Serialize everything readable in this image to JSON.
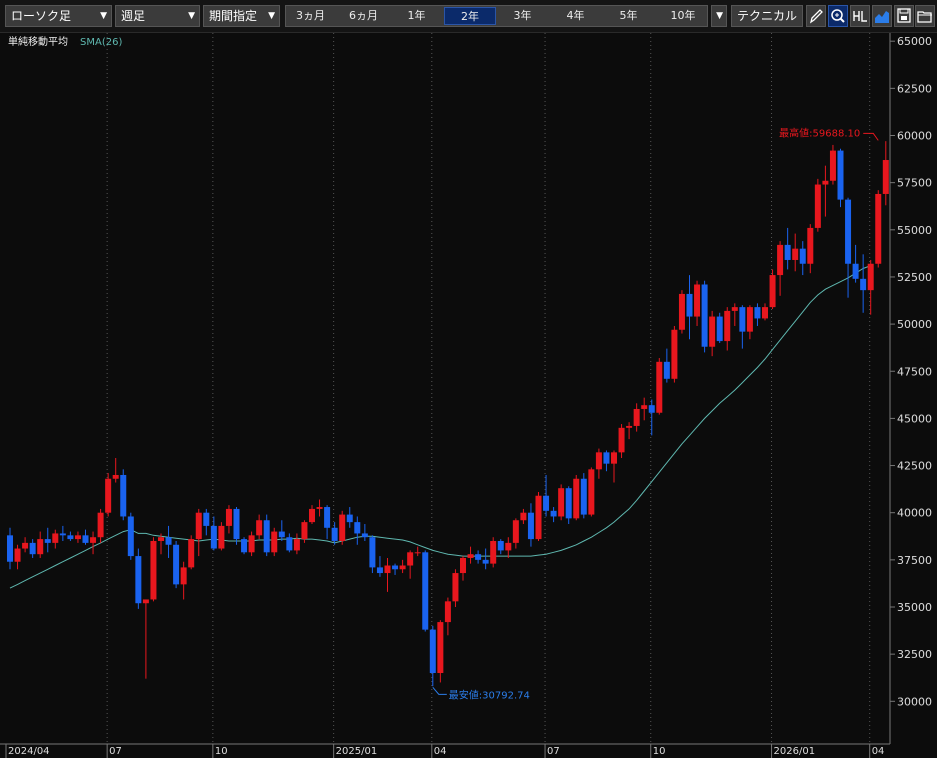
{
  "toolbar": {
    "chart_type": "ローソク足",
    "interval": "週足",
    "period_mode": "期間指定",
    "periods": [
      "3ヵ月",
      "6ヵ月",
      "1年",
      "2年",
      "3年",
      "4年",
      "5年",
      "10年"
    ],
    "selected_period": "2年",
    "technical": "テクニカル",
    "icons": [
      "pencil-icon",
      "zoom-icon",
      "output-icon",
      "chart-style-icon",
      "save-icon",
      "folder-icon"
    ]
  },
  "legend": {
    "indicator": "単純移動平均",
    "sma": "SMA(26)"
  },
  "annotations": {
    "high": "最高値:59688.10",
    "low": "最安値:30792.74"
  },
  "colors": {
    "up": "#e8171e",
    "down": "#1a63f0",
    "sma": "#5fb8b0",
    "background": "#0c0c0c",
    "grid": "#555555"
  },
  "chart_data": {
    "type": "candlestick",
    "interval": "weekly",
    "y_ticks": [
      "65000",
      "62500",
      "60000",
      "57500",
      "55000",
      "52500",
      "50000",
      "47500",
      "45000",
      "42500",
      "40000",
      "37500",
      "35000",
      "32500",
      "30000"
    ],
    "ylim": [
      28500,
      65500
    ],
    "x_tick_labels": [
      {
        "label": "2024/04",
        "index": 0
      },
      {
        "label": "07",
        "index": 13
      },
      {
        "label": "10",
        "index": 27
      },
      {
        "label": "2025/01",
        "index": 43
      },
      {
        "label": "04",
        "index": 56
      },
      {
        "label": "07",
        "index": 71
      },
      {
        "label": "10",
        "index": 85
      },
      {
        "label": "2026/01",
        "index": 101
      },
      {
        "label": "04",
        "index": 114
      }
    ],
    "grid": true,
    "series": [
      {
        "type": "ohlc",
        "ohlc": [
          [
            38800,
            39200,
            37000,
            37400
          ],
          [
            37400,
            38300,
            37000,
            38100
          ],
          [
            38100,
            38700,
            37900,
            38400
          ],
          [
            38400,
            38600,
            37600,
            37800
          ],
          [
            37800,
            39000,
            37600,
            38600
          ],
          [
            38600,
            39200,
            37900,
            38400
          ],
          [
            38400,
            39100,
            38100,
            38900
          ],
          [
            38900,
            39300,
            38500,
            38800
          ],
          [
            38800,
            39000,
            38500,
            38600
          ],
          [
            38600,
            39000,
            38400,
            38800
          ],
          [
            38800,
            39100,
            38300,
            38400
          ],
          [
            38400,
            39000,
            37800,
            38700
          ],
          [
            38700,
            40200,
            38400,
            40000
          ],
          [
            40000,
            42100,
            39800,
            41800
          ],
          [
            41800,
            42900,
            41600,
            42000
          ],
          [
            42000,
            42300,
            39600,
            39800
          ],
          [
            39800,
            40000,
            37500,
            37700
          ],
          [
            37700,
            38100,
            34900,
            35200
          ],
          [
            35200,
            35400,
            31200,
            35400
          ],
          [
            35400,
            38700,
            35300,
            38500
          ],
          [
            38500,
            38900,
            37800,
            38700
          ],
          [
            38700,
            39300,
            37600,
            38300
          ],
          [
            38300,
            38500,
            36000,
            36200
          ],
          [
            36200,
            37400,
            35400,
            37100
          ],
          [
            37100,
            38800,
            37000,
            38600
          ],
          [
            38600,
            40200,
            37700,
            40000
          ],
          [
            40000,
            40200,
            38800,
            39300
          ],
          [
            39300,
            39800,
            38000,
            38100
          ],
          [
            38100,
            39500,
            38000,
            39300
          ],
          [
            39300,
            40400,
            38900,
            40200
          ],
          [
            40200,
            40300,
            38300,
            38600
          ],
          [
            38600,
            38700,
            37800,
            37900
          ],
          [
            37900,
            39000,
            37700,
            38800
          ],
          [
            38800,
            39900,
            38600,
            39600
          ],
          [
            39600,
            39900,
            37700,
            37900
          ],
          [
            37900,
            39200,
            37700,
            39000
          ],
          [
            39000,
            39600,
            38500,
            38700
          ],
          [
            38700,
            38900,
            37900,
            38000
          ],
          [
            38000,
            38900,
            37800,
            38600
          ],
          [
            38600,
            39600,
            38400,
            39500
          ],
          [
            39500,
            40400,
            39400,
            40200
          ],
          [
            40200,
            40700,
            39800,
            40300
          ],
          [
            40300,
            40400,
            38600,
            39200
          ],
          [
            39200,
            39500,
            38300,
            38500
          ],
          [
            38500,
            40100,
            38300,
            39900
          ],
          [
            39900,
            40300,
            39200,
            39500
          ],
          [
            39500,
            39800,
            38300,
            38900
          ],
          [
            38900,
            39400,
            38500,
            38700
          ],
          [
            38700,
            38800,
            36800,
            37100
          ],
          [
            37100,
            37700,
            36600,
            36800
          ],
          [
            36800,
            37600,
            35800,
            37200
          ],
          [
            37200,
            37300,
            36700,
            37000
          ],
          [
            37000,
            37500,
            36800,
            37200
          ],
          [
            37200,
            38000,
            36500,
            37900
          ],
          [
            37900,
            38200,
            37700,
            37900
          ],
          [
            37900,
            38000,
            33700,
            33800
          ],
          [
            33800,
            34000,
            30800,
            31500
          ],
          [
            31500,
            34300,
            31000,
            34200
          ],
          [
            34200,
            35500,
            33500,
            35300
          ],
          [
            35300,
            37000,
            35000,
            36800
          ],
          [
            36800,
            37700,
            36400,
            37600
          ],
          [
            37600,
            38200,
            37300,
            37800
          ],
          [
            37800,
            38000,
            37300,
            37500
          ],
          [
            37500,
            38100,
            37000,
            37300
          ],
          [
            37300,
            38700,
            37100,
            38500
          ],
          [
            38500,
            38600,
            37800,
            38000
          ],
          [
            38000,
            38700,
            37600,
            38400
          ],
          [
            38400,
            39700,
            38100,
            39600
          ],
          [
            39600,
            40200,
            39400,
            40000
          ],
          [
            40000,
            40500,
            38200,
            38600
          ],
          [
            38600,
            41100,
            38500,
            40900
          ],
          [
            40900,
            42000,
            39800,
            40100
          ],
          [
            40100,
            40300,
            39500,
            39800
          ],
          [
            39800,
            41500,
            39600,
            41300
          ],
          [
            41300,
            41400,
            39400,
            39700
          ],
          [
            39700,
            42000,
            39600,
            41800
          ],
          [
            41800,
            42100,
            39700,
            39900
          ],
          [
            39900,
            42400,
            39800,
            42300
          ],
          [
            42300,
            43400,
            41800,
            43200
          ],
          [
            43200,
            43300,
            42200,
            42600
          ],
          [
            42600,
            43300,
            41600,
            43200
          ],
          [
            43200,
            44700,
            42900,
            44500
          ],
          [
            44500,
            44800,
            43900,
            44600
          ],
          [
            44600,
            45800,
            44300,
            45500
          ],
          [
            45500,
            46100,
            44900,
            45700
          ],
          [
            45700,
            46000,
            44100,
            45300
          ],
          [
            45300,
            48200,
            45200,
            48000
          ],
          [
            48000,
            48700,
            46900,
            47100
          ],
          [
            47100,
            49900,
            46900,
            49700
          ],
          [
            49700,
            51800,
            49500,
            51600
          ],
          [
            51600,
            52600,
            49200,
            50400
          ],
          [
            50400,
            52300,
            49900,
            52100
          ],
          [
            52100,
            52300,
            48500,
            48800
          ],
          [
            48800,
            50700,
            48300,
            50400
          ],
          [
            50400,
            50600,
            49000,
            49100
          ],
          [
            49100,
            50900,
            48600,
            50700
          ],
          [
            50700,
            51100,
            49900,
            50900
          ],
          [
            50900,
            51000,
            48700,
            49600
          ],
          [
            49600,
            51000,
            49200,
            50900
          ],
          [
            50900,
            51100,
            49900,
            50300
          ],
          [
            50300,
            51100,
            50200,
            50900
          ],
          [
            50900,
            52900,
            50800,
            52600
          ],
          [
            52600,
            54400,
            51500,
            54200
          ],
          [
            54200,
            55100,
            52900,
            53400
          ],
          [
            53400,
            54800,
            52800,
            54000
          ],
          [
            54000,
            54400,
            52600,
            53200
          ],
          [
            53200,
            55300,
            52700,
            55100
          ],
          [
            55100,
            57700,
            54900,
            57400
          ],
          [
            57400,
            58400,
            55700,
            57600
          ],
          [
            57600,
            59500,
            57400,
            59200
          ],
          [
            59200,
            59300,
            56200,
            56600
          ],
          [
            56600,
            56700,
            51400,
            53200
          ],
          [
            53200,
            54200,
            52200,
            52400
          ],
          [
            52400,
            53700,
            50600,
            51800
          ],
          [
            51800,
            53400,
            50500,
            53200
          ],
          [
            53200,
            57100,
            53000,
            56900
          ],
          [
            56900,
            59700,
            56300,
            58700
          ]
        ]
      },
      {
        "type": "line",
        "name": "SMA(26)",
        "values": [
          36000,
          36200,
          36400,
          36600,
          36800,
          37000,
          37200,
          37400,
          37600,
          37800,
          38000,
          38200,
          38400,
          38600,
          38800,
          39000,
          39100,
          38900,
          38900,
          38800,
          38750,
          38700,
          38650,
          38600,
          38550,
          38500,
          38550,
          38600,
          38550,
          38500,
          38500,
          38500,
          38500,
          38550,
          38550,
          38550,
          38600,
          38600,
          38650,
          38600,
          38600,
          38550,
          38500,
          38400,
          38500,
          38600,
          38700,
          38750,
          38750,
          38700,
          38650,
          38600,
          38550,
          38450,
          38300,
          38150,
          38000,
          37900,
          37800,
          37750,
          37700,
          37700,
          37700,
          37700,
          37700,
          37700,
          37700,
          37700,
          37700,
          37700,
          37750,
          37800,
          37900,
          38000,
          38150,
          38300,
          38500,
          38700,
          38950,
          39200,
          39500,
          39850,
          40200,
          40650,
          41150,
          41650,
          42150,
          42650,
          43150,
          43650,
          44100,
          44550,
          45000,
          45400,
          45800,
          46150,
          46500,
          46900,
          47300,
          47700,
          48150,
          48650,
          49150,
          49650,
          50150,
          50650,
          51150,
          51550,
          51850,
          52050,
          52250,
          52450,
          52700,
          52950,
          53100
        ]
      }
    ],
    "annotations": [
      {
        "text": "最高値:59688.10",
        "index": 115,
        "value": 59688.1
      },
      {
        "text": "最安値:30792.74",
        "index": 56,
        "value": 30792.74
      }
    ]
  }
}
